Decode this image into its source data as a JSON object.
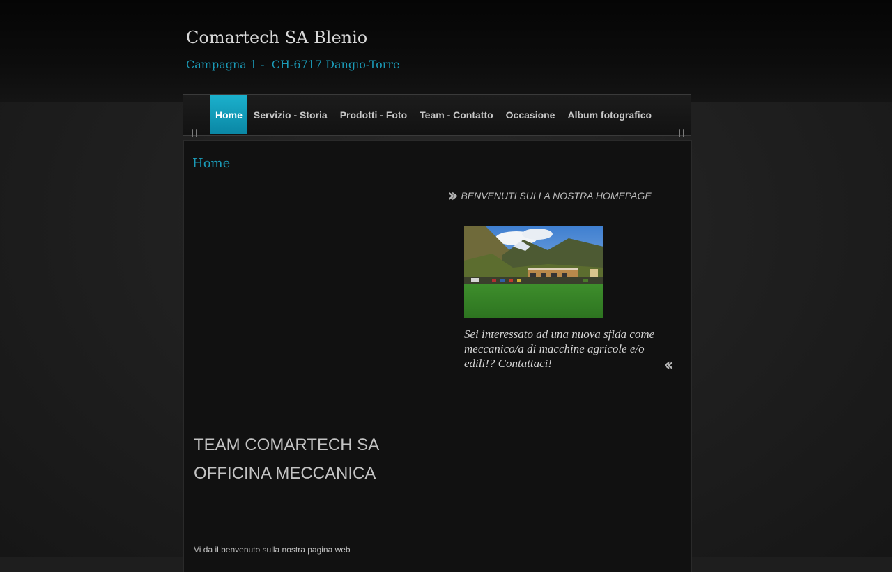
{
  "header": {
    "title": "Comartech SA Blenio",
    "subtitle": "Campagna 1 -  CH-6717 Dangio-Torre"
  },
  "nav": {
    "items": [
      {
        "label": "Home",
        "active": true
      },
      {
        "label": "Servizio - Storia",
        "active": false
      },
      {
        "label": "Prodotti - Foto",
        "active": false
      },
      {
        "label": "Team - Contatto",
        "active": false
      },
      {
        "label": "Occasione",
        "active": false
      },
      {
        "label": "Album fotografico",
        "active": false
      }
    ]
  },
  "main": {
    "page_heading": "Home",
    "welcome_banner": "BENVENUTI SULLA NOSTRA HOMEPAGE",
    "photo_icon": "photo-landscape",
    "cta_text": "Sei  interessato ad una nuova sfida come meccanico/a di macchine agricole e/o edili!? Contattaci!",
    "team_heading_line1": "TEAM COMARTECH SA",
    "team_heading_line2": "OFFICINA MECCANICA",
    "welcome_small": "Vi da il benvenuto sulla nostra pagina web"
  },
  "colors": {
    "accent": "#1b9bb8",
    "active_nav": "#0a86a4",
    "background": "#111111"
  }
}
